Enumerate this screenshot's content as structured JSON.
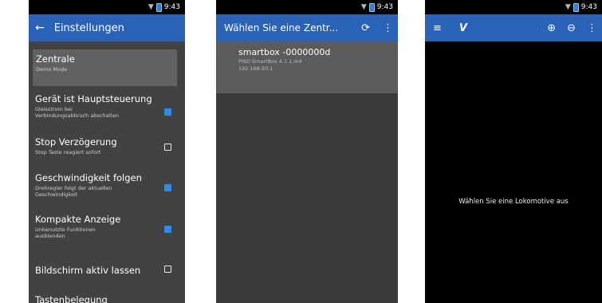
{
  "status": {
    "time": "9:43"
  },
  "screen1": {
    "title": "Einstellungen",
    "settings": [
      {
        "title": "Zentrale",
        "subtitle": "Demo Mode"
      },
      {
        "title": "Gerät ist Hauptsteuerung",
        "subtitle_lines": [
          "Gleisstrom bei",
          "Verbindungsabbruch abschalten"
        ],
        "checked": true
      },
      {
        "title": "Stop Verzögerung",
        "subtitle": "Stop Taste reagiert sofort",
        "checked": false
      },
      {
        "title": "Geschwindigkeit folgen",
        "subtitle_lines": [
          "Drehregler folgt der aktuellen",
          "Geschwindigkeit"
        ],
        "checked": true
      },
      {
        "title": "Kompakte Anzeige",
        "subtitle_lines": [
          "Unbenutzte Funktionen",
          "ausblenden"
        ],
        "checked": true
      },
      {
        "title": "Bildschirm aktiv lassen",
        "checked": false
      },
      {
        "title": "Tastenbelegung"
      }
    ]
  },
  "screen2": {
    "title": "Wählen Sie eine Zentr...",
    "item": {
      "name": "smartbox -0000000d",
      "line1": "PIKO SmartBox 4.1.1.m4",
      "line2": "192.168.93.1"
    }
  },
  "screen3": {
    "message": "Wählen Sie eine Lokomotive aus"
  },
  "colors": {
    "appbar": "#2962b7",
    "checkbox_checked": "#2e8ae6",
    "settings_bg": "#424242",
    "selected_row": "#616161"
  }
}
